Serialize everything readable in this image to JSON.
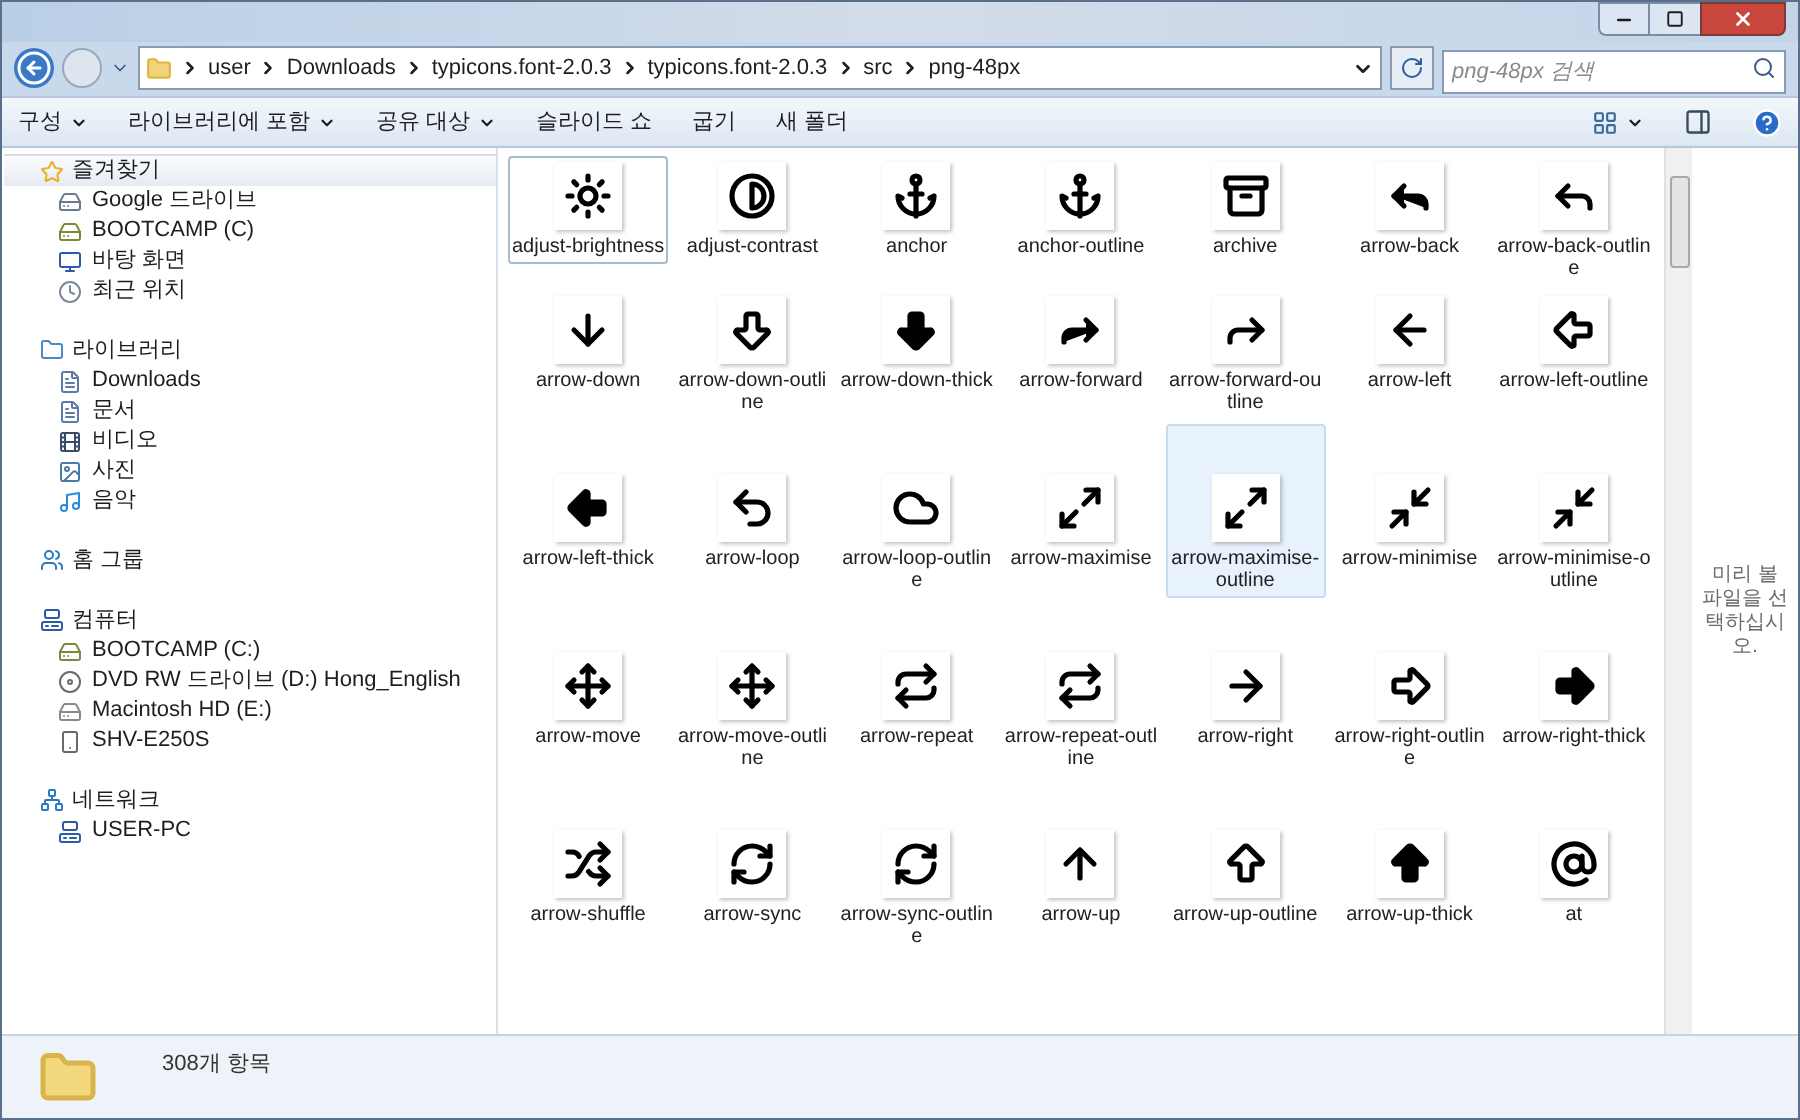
{
  "address_bar": {
    "path": [
      "user",
      "Downloads",
      "typicons.font-2.0.3",
      "typicons.font-2.0.3",
      "src",
      "png-48px"
    ]
  },
  "search": {
    "placeholder": "png-48px 검색"
  },
  "toolbar": [
    {
      "label": "구성",
      "menu": true
    },
    {
      "label": "라이브러리에 포함",
      "menu": true
    },
    {
      "label": "공유 대상",
      "menu": true
    },
    {
      "label": "슬라이드 쇼",
      "menu": false
    },
    {
      "label": "굽기",
      "menu": false
    },
    {
      "label": "새 폴더",
      "menu": false
    }
  ],
  "sidebar": [
    {
      "label": "즐겨찾기",
      "kind": "favorites",
      "selected": true,
      "children": [
        {
          "label": "Google 드라이브",
          "kind": "cloud"
        },
        {
          "label": "BOOTCAMP (C)",
          "kind": "drive"
        },
        {
          "label": "바탕 화면",
          "kind": "desktop"
        },
        {
          "label": "최근 위치",
          "kind": "recent"
        }
      ]
    },
    {
      "label": "라이브러리",
      "kind": "library",
      "selected": false,
      "children": [
        {
          "label": "Downloads",
          "kind": "document"
        },
        {
          "label": "문서",
          "kind": "document"
        },
        {
          "label": "비디오",
          "kind": "video"
        },
        {
          "label": "사진",
          "kind": "image"
        },
        {
          "label": "음악",
          "kind": "music"
        }
      ]
    },
    {
      "label": "홈 그룹",
      "kind": "homegroup",
      "selected": false
    },
    {
      "label": "컴퓨터",
      "kind": "computer",
      "selected": false,
      "children": [
        {
          "label": "BOOTCAMP (C:)",
          "kind": "drive"
        },
        {
          "label": "DVD RW 드라이브 (D:) Hong_English",
          "kind": "disc"
        },
        {
          "label": "Macintosh HD (E:)",
          "kind": "harddisk"
        },
        {
          "label": "SHV-E250S",
          "kind": "phone"
        }
      ]
    },
    {
      "label": "네트워크",
      "kind": "network",
      "selected": false,
      "children": [
        {
          "label": "USER-PC",
          "kind": "computer"
        }
      ]
    }
  ],
  "files": [
    {
      "name": "adjust-brightness",
      "selected": false,
      "focused": true
    },
    {
      "name": "adjust-contrast",
      "selected": false,
      "focused": false
    },
    {
      "name": "anchor",
      "selected": false,
      "focused": false
    },
    {
      "name": "anchor-outline",
      "selected": false,
      "focused": false
    },
    {
      "name": "archive",
      "selected": false,
      "focused": false
    },
    {
      "name": "arrow-back",
      "selected": false,
      "focused": false
    },
    {
      "name": "arrow-back-outline",
      "selected": false,
      "focused": false
    },
    {
      "name": "arrow-down",
      "selected": false,
      "focused": false
    },
    {
      "name": "arrow-down-outline",
      "selected": false,
      "focused": false
    },
    {
      "name": "arrow-down-thick",
      "selected": false,
      "focused": false
    },
    {
      "name": "arrow-forward",
      "selected": false,
      "focused": false
    },
    {
      "name": "arrow-forward-outline",
      "selected": false,
      "focused": false
    },
    {
      "name": "arrow-left",
      "selected": false,
      "focused": false
    },
    {
      "name": "arrow-left-outline",
      "selected": false,
      "focused": false
    },
    {
      "name": "arrow-left-thick",
      "selected": false,
      "focused": false
    },
    {
      "name": "arrow-loop",
      "selected": false,
      "focused": false
    },
    {
      "name": "arrow-loop-outline",
      "selected": false,
      "focused": false
    },
    {
      "name": "arrow-maximise",
      "selected": false,
      "focused": false
    },
    {
      "name": "arrow-maximise-outline",
      "selected": true,
      "focused": false
    },
    {
      "name": "arrow-minimise",
      "selected": false,
      "focused": false
    },
    {
      "name": "arrow-minimise-outline",
      "selected": false,
      "focused": false
    },
    {
      "name": "arrow-move",
      "selected": false,
      "focused": false
    },
    {
      "name": "arrow-move-outline",
      "selected": false,
      "focused": false
    },
    {
      "name": "arrow-repeat",
      "selected": false,
      "focused": false
    },
    {
      "name": "arrow-repeat-outline",
      "selected": false,
      "focused": false
    },
    {
      "name": "arrow-right",
      "selected": false,
      "focused": false
    },
    {
      "name": "arrow-right-outline",
      "selected": false,
      "focused": false
    },
    {
      "name": "arrow-right-thick",
      "selected": false,
      "focused": false
    },
    {
      "name": "arrow-shuffle",
      "selected": false,
      "focused": false
    },
    {
      "name": "arrow-sync",
      "selected": false,
      "focused": false
    },
    {
      "name": "arrow-sync-outline",
      "selected": false,
      "focused": false
    },
    {
      "name": "arrow-up",
      "selected": false,
      "focused": false
    },
    {
      "name": "arrow-up-outline",
      "selected": false,
      "focused": false
    },
    {
      "name": "arrow-up-thick",
      "selected": false,
      "focused": false
    },
    {
      "name": "at",
      "selected": false,
      "focused": false
    }
  ],
  "preview_pane": {
    "message": "미리 볼 파일을 선택하십시오."
  },
  "status_bar": {
    "count": "308개 항목"
  }
}
